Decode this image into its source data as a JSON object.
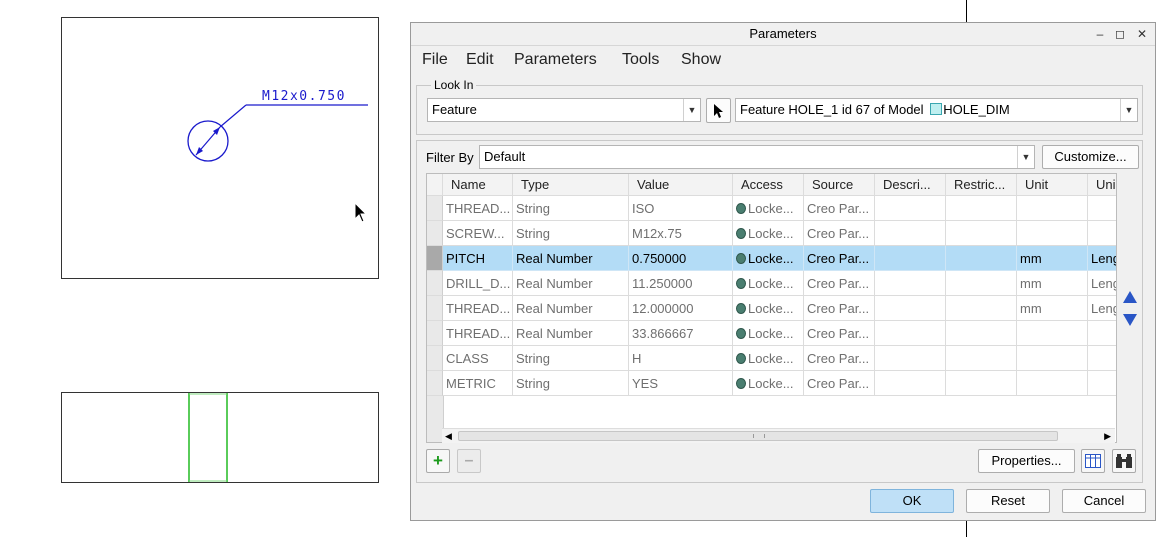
{
  "drawing": {
    "dimension_label": "M12x0.750"
  },
  "dialog": {
    "title": "Parameters",
    "menus": [
      "File",
      "Edit",
      "Parameters",
      "Tools",
      "Show"
    ],
    "look_in": {
      "label": "Look In",
      "type_value": "Feature",
      "feature_prefix": "Feature HOLE_1 id 67 of Model",
      "model_name": "HOLE_DIM"
    },
    "filter": {
      "label": "Filter By",
      "value": "Default",
      "customize_label": "Customize..."
    },
    "table": {
      "columns": [
        "Name",
        "Type",
        "Value",
        "Access",
        "Source",
        "Descri...",
        "Restric...",
        "Unit",
        "Uni"
      ],
      "rows": [
        {
          "name": "THREAD...",
          "type": "String",
          "value": "ISO",
          "access": "Locke...",
          "source": "Creo Par...",
          "unit": "",
          "unit2": "",
          "selected": false
        },
        {
          "name": "SCREW...",
          "type": "String",
          "value": "M12x.75",
          "access": "Locke...",
          "source": "Creo Par...",
          "unit": "",
          "unit2": "",
          "selected": false
        },
        {
          "name": "PITCH",
          "type": "Real Number",
          "value": "0.750000",
          "access": "Locke...",
          "source": "Creo Par...",
          "unit": "mm",
          "unit2": "Leng",
          "selected": true
        },
        {
          "name": "DRILL_D...",
          "type": "Real Number",
          "value": "11.250000",
          "access": "Locke...",
          "source": "Creo Par...",
          "unit": "mm",
          "unit2": "Leng",
          "selected": false
        },
        {
          "name": "THREAD...",
          "type": "Real Number",
          "value": "12.000000",
          "access": "Locke...",
          "source": "Creo Par...",
          "unit": "mm",
          "unit2": "Leng",
          "selected": false
        },
        {
          "name": "THREAD...",
          "type": "Real Number",
          "value": "33.866667",
          "access": "Locke...",
          "source": "Creo Par...",
          "unit": "",
          "unit2": "",
          "selected": false
        },
        {
          "name": "CLASS",
          "type": "String",
          "value": "H",
          "access": "Locke...",
          "source": "Creo Par...",
          "unit": "",
          "unit2": "",
          "selected": false
        },
        {
          "name": "METRIC",
          "type": "String",
          "value": "YES",
          "access": "Locke...",
          "source": "Creo Par...",
          "unit": "",
          "unit2": "",
          "selected": false
        }
      ]
    },
    "buttons": {
      "properties": "Properties...",
      "ok": "OK",
      "reset": "Reset",
      "cancel": "Cancel"
    },
    "icons": {
      "add": "plus-icon",
      "remove": "minus-icon",
      "move_up": "arrow-up-icon",
      "move_down": "arrow-down-icon",
      "columns": "table-columns-icon",
      "find": "binoculars-icon",
      "select": "cursor-arrow-icon"
    },
    "colors": {
      "selection": "#b3dcf6",
      "ok_button": "#bfe0f7",
      "dimension": "#1a1acc",
      "hole_outline": "#22bb22"
    }
  }
}
